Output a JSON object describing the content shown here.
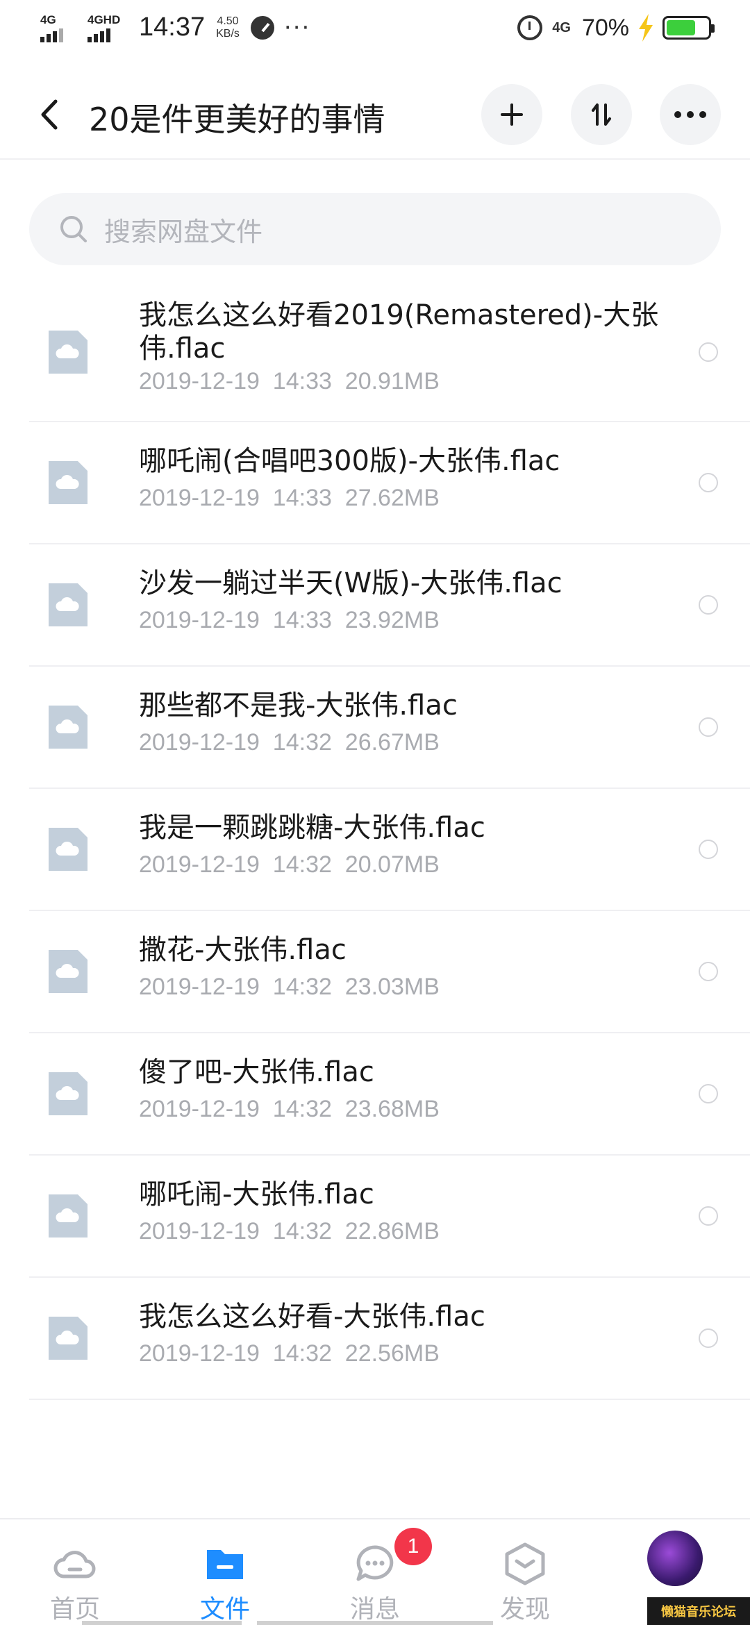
{
  "status_bar": {
    "signal1_label": "4G",
    "signal2_label": "4GHD",
    "time": "14:37",
    "speed_value": "4.50",
    "speed_unit": "KB/s",
    "more_dots": "···",
    "network_label": "4G",
    "battery_percent": "70%",
    "battery_level": 0.7
  },
  "header": {
    "title": "20是件更美好的事情"
  },
  "search": {
    "placeholder": "搜索网盘文件"
  },
  "files": [
    {
      "name": "我怎么这么好看2019(Remastered)-大张伟.flac",
      "meta": "2019-12-19  14:33  20.91MB"
    },
    {
      "name": "哪吒闹(合唱吧300版)-大张伟.flac",
      "meta": "2019-12-19  14:33  27.62MB"
    },
    {
      "name": "沙发一躺过半天(W版)-大张伟.flac",
      "meta": "2019-12-19  14:33  23.92MB"
    },
    {
      "name": "那些都不是我-大张伟.flac",
      "meta": "2019-12-19  14:32  26.67MB"
    },
    {
      "name": "我是一颗跳跳糖-大张伟.flac",
      "meta": "2019-12-19  14:32  20.07MB"
    },
    {
      "name": "撒花-大张伟.flac",
      "meta": "2019-12-19  14:32  23.03MB"
    },
    {
      "name": "傻了吧-大张伟.flac",
      "meta": "2019-12-19  14:32  23.68MB"
    },
    {
      "name": "哪吒闹-大张伟.flac",
      "meta": "2019-12-19  14:32  22.86MB"
    },
    {
      "name": "我怎么这么好看-大张伟.flac",
      "meta": "2019-12-19  14:32  22.56MB"
    }
  ],
  "nav": {
    "items": [
      {
        "label": "首页",
        "icon": "cloud-home-icon"
      },
      {
        "label": "文件",
        "icon": "folder-icon"
      },
      {
        "label": "消息",
        "icon": "chat-icon"
      },
      {
        "label": "发现",
        "icon": "discover-icon"
      }
    ],
    "messages_badge": "1"
  },
  "watermark": "懒猫音乐论坛",
  "colors": {
    "accent": "#1e8dff",
    "badge": "#f2364a",
    "battery": "#3ccf3c",
    "file_icon": "#c3cfdb"
  }
}
